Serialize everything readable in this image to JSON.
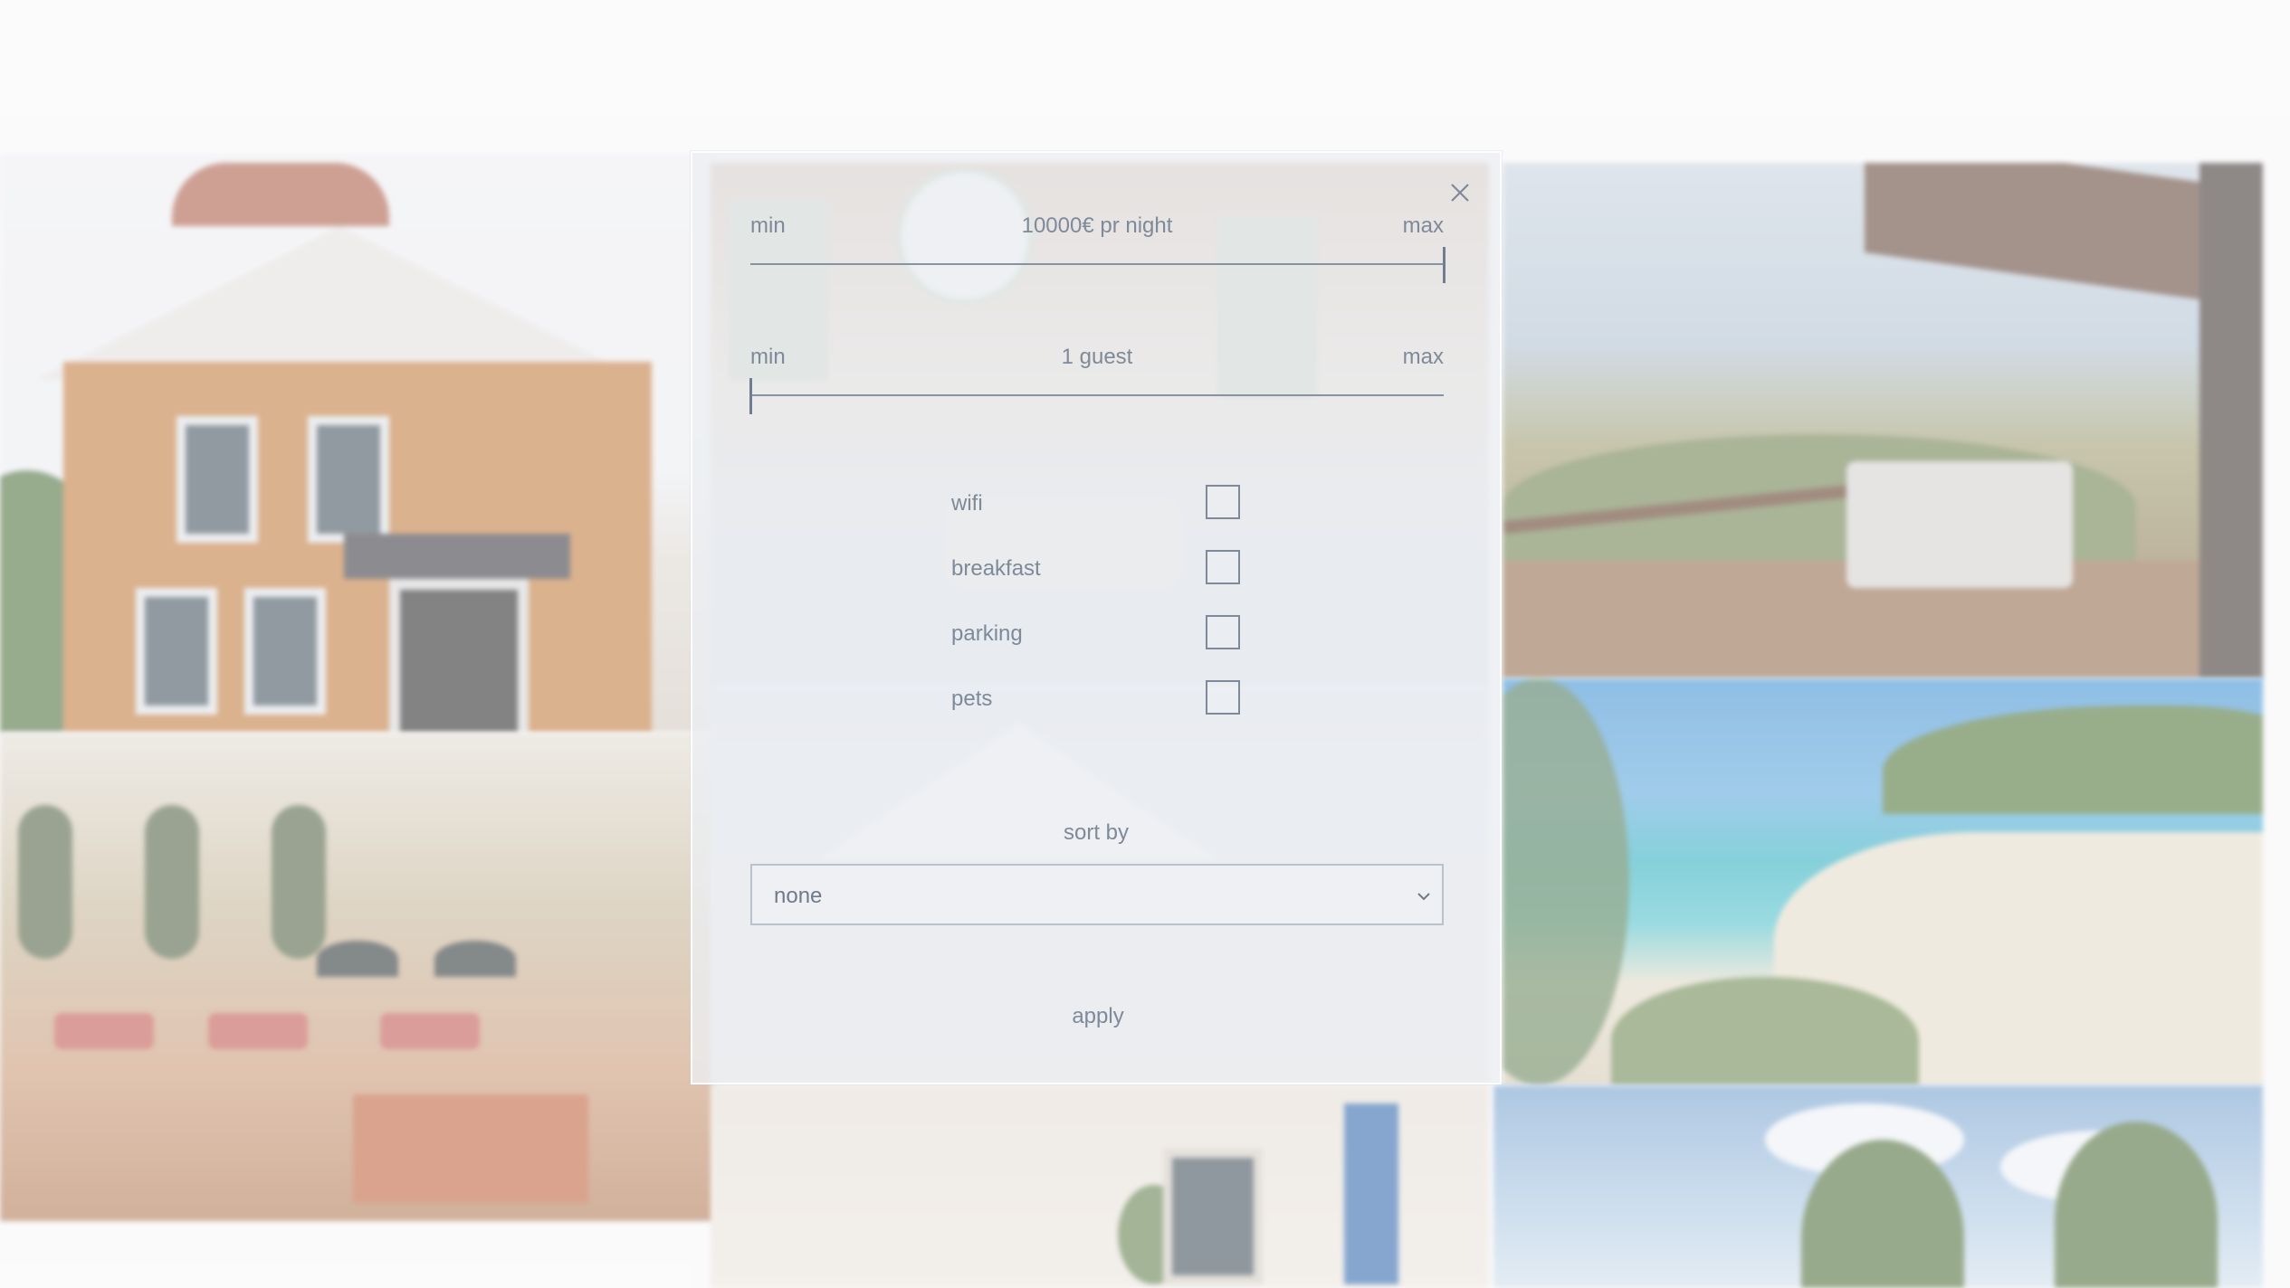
{
  "filter_modal": {
    "price_range": {
      "min_label": "min",
      "max_label": "max",
      "value_text": "10000€ pr night",
      "value_fraction": 1.0
    },
    "guest_range": {
      "min_label": "min",
      "max_label": "max",
      "value_text": "1 guest",
      "value_fraction": 0.0
    },
    "amenities": [
      {
        "label": "wifi",
        "checked": false
      },
      {
        "label": "breakfast",
        "checked": false
      },
      {
        "label": "parking",
        "checked": false
      },
      {
        "label": "pets",
        "checked": false
      }
    ],
    "sort": {
      "label": "sort by",
      "selected": "none"
    },
    "apply_label": "apply",
    "close_icon": "close-icon"
  },
  "colors": {
    "text": "#7e8a99",
    "track": "#8593a3",
    "modal_bg": "#eceef2"
  }
}
